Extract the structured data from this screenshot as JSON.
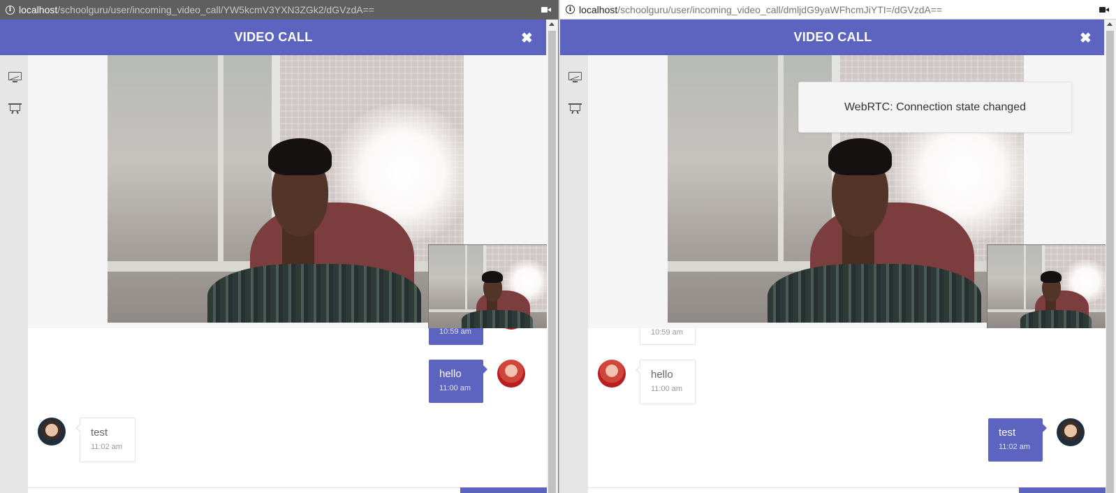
{
  "left_window": {
    "url_host": "localhost",
    "url_path": "/schoolguru/user/incoming_video_call/YW5kcmV3YXN3ZGk2/dGVzdA==",
    "title": "VIDEO CALL",
    "close_glyph": "✖",
    "messages": [
      {
        "text": "",
        "time": "10:59 am",
        "direction": "out",
        "avatar": "female-avatar"
      },
      {
        "text": "hello",
        "time": "11:00 am",
        "direction": "out",
        "avatar": "female-avatar"
      },
      {
        "text": "test",
        "time": "11:02 am",
        "direction": "in",
        "avatar": "male-avatar"
      }
    ]
  },
  "right_window": {
    "url_host": "localhost",
    "url_path": "/schoolguru/user/incoming_video_call/dmljdG9yaWFhcmJiYTI=/dGVzdA==",
    "title": "VIDEO CALL",
    "close_glyph": "✖",
    "toast": "WebRTC: Connection state changed",
    "messages": [
      {
        "text": "",
        "time": "10:59 am",
        "direction": "in",
        "avatar": "female-avatar"
      },
      {
        "text": "hello",
        "time": "11:00 am",
        "direction": "in",
        "avatar": "female-avatar"
      },
      {
        "text": "test",
        "time": "11:02 am",
        "direction": "out",
        "avatar": "male-avatar"
      }
    ]
  },
  "sidebar_icons": [
    "screen-share-icon",
    "presentation-icon"
  ],
  "colors": {
    "accent": "#5c64c0",
    "sidebar": "#e6e6e6",
    "video_bg": "#f5f5f5"
  }
}
